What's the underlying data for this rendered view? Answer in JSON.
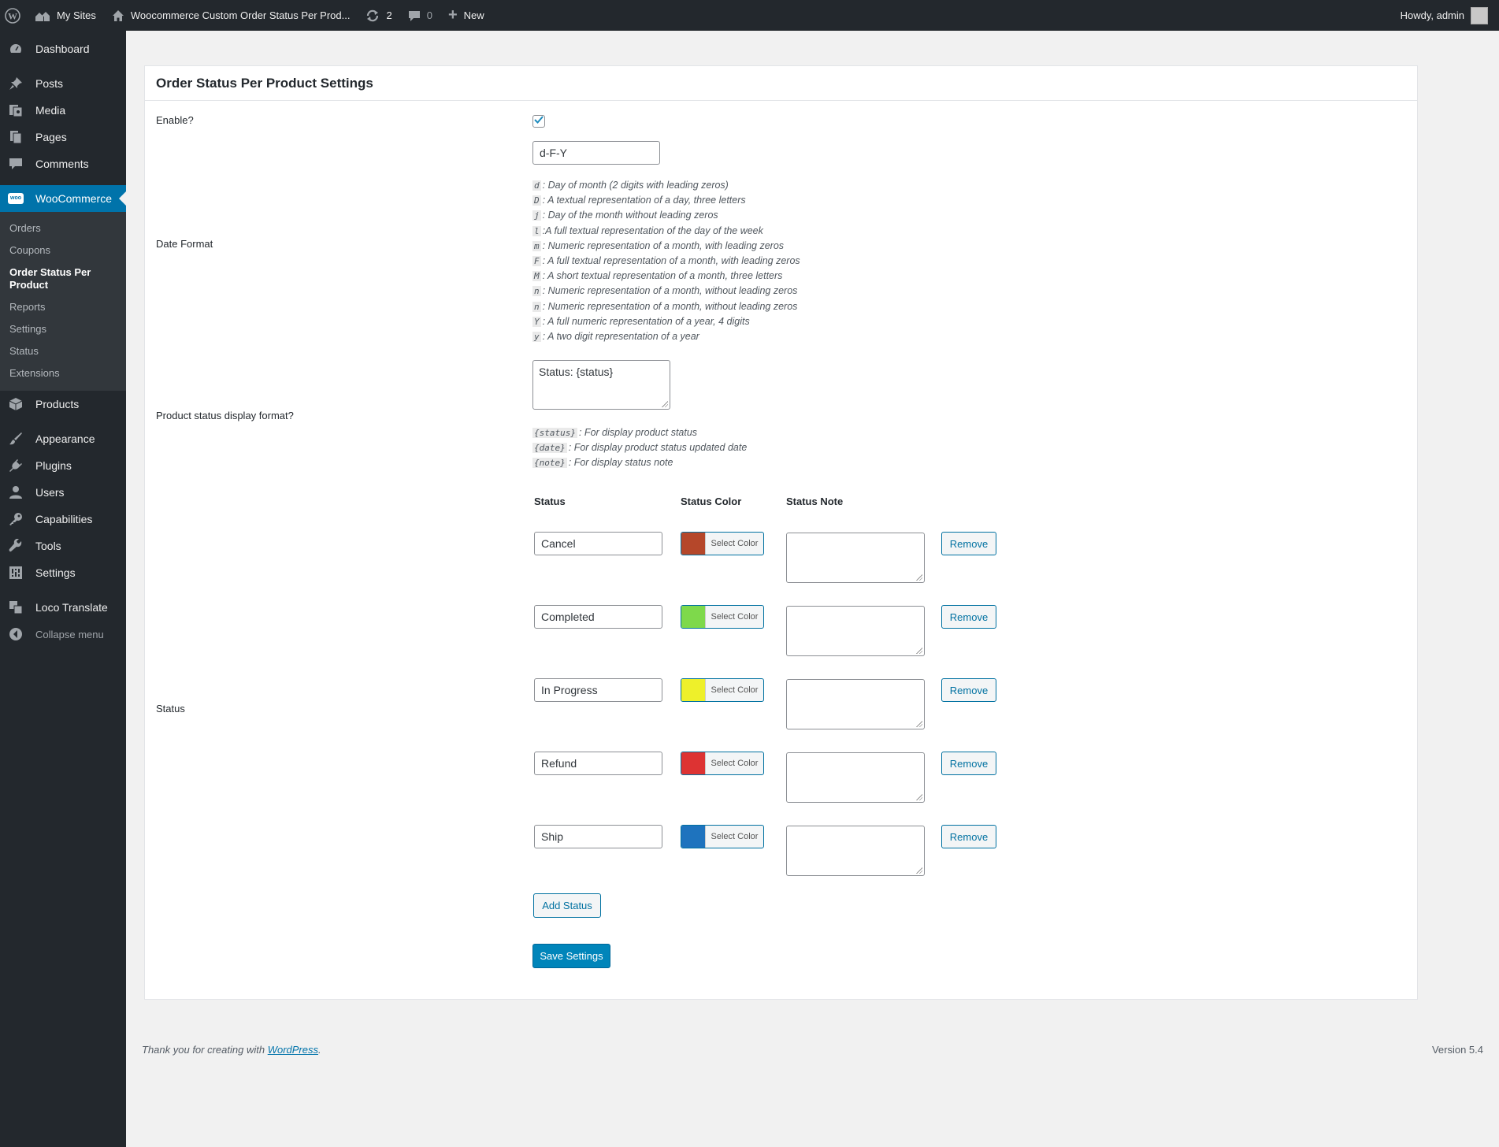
{
  "adminbar": {
    "my_sites": "My Sites",
    "site_name": "Woocommerce Custom Order Status Per Prod...",
    "updates_count": "2",
    "comments_count": "0",
    "new_label": "New",
    "howdy": "Howdy, admin"
  },
  "sidebar": {
    "items_top": [
      {
        "label": "Dashboard",
        "icon": "dashboard-icon"
      },
      {
        "label": "Posts",
        "icon": "pin-icon"
      },
      {
        "label": "Media",
        "icon": "media-icon"
      },
      {
        "label": "Pages",
        "icon": "pages-icon"
      },
      {
        "label": "Comments",
        "icon": "comment-icon"
      }
    ],
    "woocommerce": {
      "label": "WooCommerce",
      "icon_text": "woo"
    },
    "woo_submenu": [
      "Orders",
      "Coupons",
      "Order Status Per Product",
      "Reports",
      "Settings",
      "Status",
      "Extensions"
    ],
    "items_bottom": [
      {
        "label": "Products",
        "icon": "box-icon"
      },
      {
        "label": "Appearance",
        "icon": "brush-icon"
      },
      {
        "label": "Plugins",
        "icon": "plug-icon"
      },
      {
        "label": "Users",
        "icon": "user-icon"
      },
      {
        "label": "Capabilities",
        "icon": "key-icon"
      },
      {
        "label": "Tools",
        "icon": "wrench-icon"
      },
      {
        "label": "Settings",
        "icon": "settings-icon"
      },
      {
        "label": "Loco Translate",
        "icon": "translate-icon"
      },
      {
        "label": "Collapse menu",
        "icon": "collapse-icon"
      }
    ]
  },
  "settings": {
    "title": "Order Status Per Product Settings",
    "enable_label": "Enable?",
    "enable_checked": true,
    "date_format_label": "Date Format",
    "date_format_value": "d-F-Y",
    "date_help": [
      {
        "code": "d",
        "text": ": Day of month (2 digits with leading zeros)"
      },
      {
        "code": "D",
        "text": ": A textual representation of a day, three letters"
      },
      {
        "code": "j",
        "text": ": Day of the month without leading zeros"
      },
      {
        "code": "l",
        "text": ":A full textual representation of the day of the week"
      },
      {
        "code": "m",
        "text": ": Numeric representation of a month, with leading zeros"
      },
      {
        "code": "F",
        "text": ": A full textual representation of a month, with leading zeros"
      },
      {
        "code": "M",
        "text": ": A short textual representation of a month, three letters"
      },
      {
        "code": "n",
        "text": ": Numeric representation of a month, without leading zeros"
      },
      {
        "code": "n",
        "text": ": Numeric representation of a month, without leading zeros"
      },
      {
        "code": "Y",
        "text": ": A full numeric representation of a year, 4 digits"
      },
      {
        "code": "y",
        "text": ": A two digit representation of a year"
      }
    ],
    "display_format_label": "Product status display format?",
    "display_format_value": "Status: {status}",
    "display_help": [
      {
        "code": "{status}",
        "text": ": For display product status"
      },
      {
        "code": "{date}",
        "text": ": For display product status updated date"
      },
      {
        "code": "{note}",
        "text": ": For display status note"
      }
    ],
    "status_label": "Status",
    "columns": {
      "status": "Status",
      "color": "Status Color",
      "note": "Status Note"
    },
    "statuses": [
      {
        "name": "Cancel",
        "color": "#b5472a",
        "note": ""
      },
      {
        "name": "Completed",
        "color": "#7ed94b",
        "note": ""
      },
      {
        "name": "In Progress",
        "color": "#eef02a",
        "note": ""
      },
      {
        "name": "Refund",
        "color": "#dd3333",
        "note": ""
      },
      {
        "name": "Ship",
        "color": "#1e73be",
        "note": ""
      }
    ],
    "select_color_label": "Select Color",
    "remove_label": "Remove",
    "add_status_label": "Add Status",
    "save_label": "Save Settings"
  },
  "footer": {
    "thanks_prefix": "Thank you for creating with ",
    "wordpress_link": "WordPress",
    "thanks_suffix": ".",
    "version": "Version 5.4"
  }
}
